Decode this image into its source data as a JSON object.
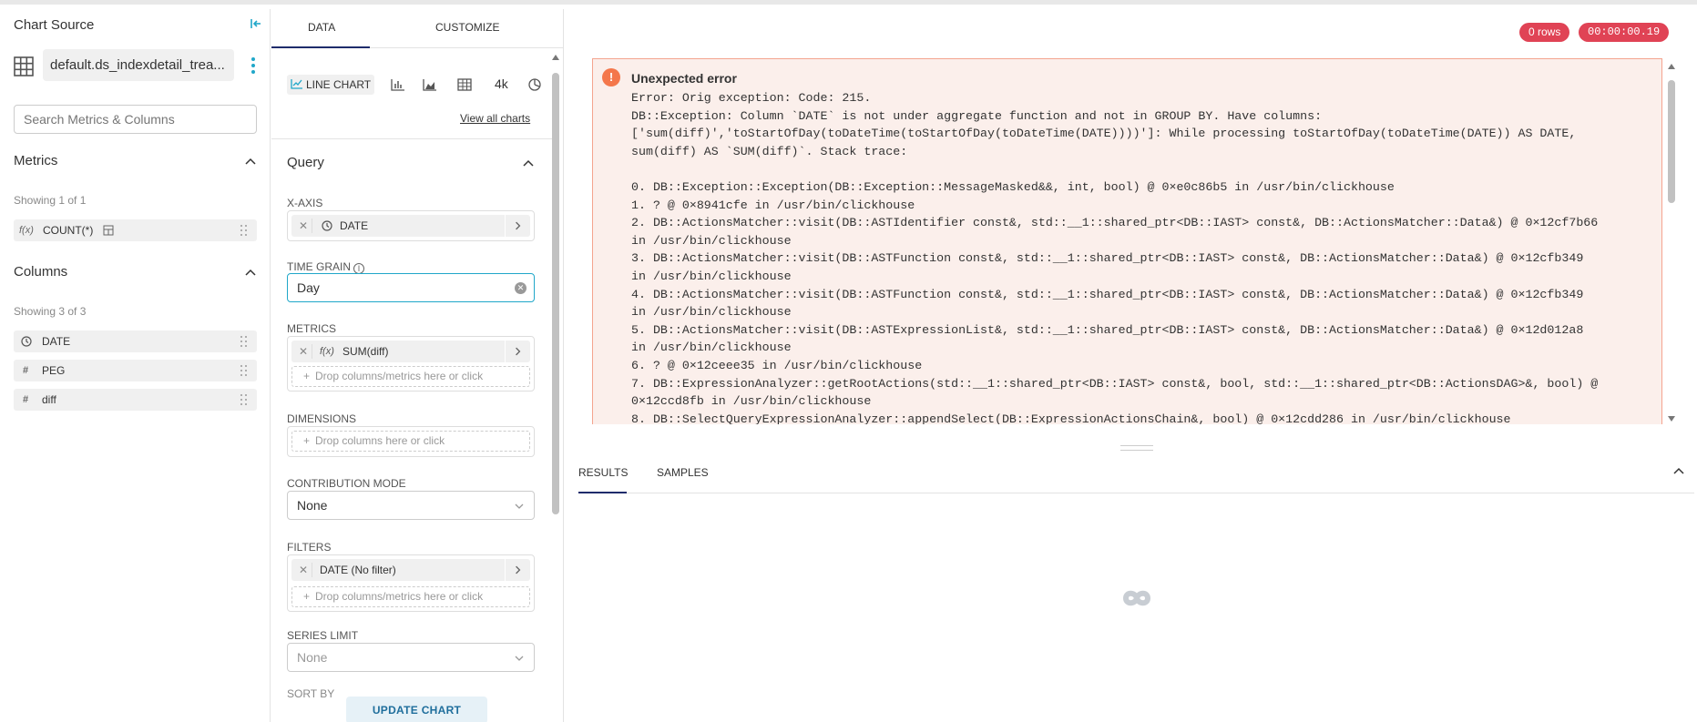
{
  "left_panel": {
    "title": "Chart Source",
    "dataset_name": "default.ds_indexdetail_trea...",
    "search_placeholder": "Search Metrics & Columns",
    "metrics": {
      "heading": "Metrics",
      "showing": "Showing 1 of 1",
      "items": [
        {
          "icon": "f(x)",
          "label": "COUNT(*)"
        }
      ]
    },
    "columns": {
      "heading": "Columns",
      "showing": "Showing 3 of 3",
      "items": [
        {
          "icon": "clock-icon",
          "label": "DATE"
        },
        {
          "icon": "#",
          "label": "PEG"
        },
        {
          "icon": "#",
          "label": "diff"
        }
      ]
    }
  },
  "middle_panel": {
    "tabs": [
      "DATA",
      "CUSTOMIZE"
    ],
    "viz": {
      "current": "LINE CHART",
      "big_number_label": "4k",
      "view_all": "View all charts"
    },
    "query_heading": "Query",
    "x_axis": {
      "label": "X-AXIS",
      "value": "DATE"
    },
    "time_grain": {
      "label": "TIME GRAIN",
      "value": "Day"
    },
    "metrics": {
      "label": "METRICS",
      "value": "SUM(diff)",
      "drop_hint": "Drop columns/metrics here or click"
    },
    "dimensions": {
      "label": "DIMENSIONS",
      "drop_hint": "Drop columns here or click"
    },
    "contribution_mode": {
      "label": "CONTRIBUTION MODE",
      "value": "None"
    },
    "filters": {
      "label": "FILTERS",
      "value": "DATE (No filter)",
      "drop_hint": "Drop columns/metrics here or click"
    },
    "series_limit": {
      "label": "SERIES LIMIT",
      "value": "None"
    },
    "sort_by": {
      "label": "SORT BY"
    },
    "update_button": "UPDATE CHART"
  },
  "right_panel": {
    "rows_badge": "0 rows",
    "timer_badge": "00:00:00.19",
    "error": {
      "title": "Unexpected error",
      "body": "Error: Orig exception: Code: 215.\nDB::Exception: Column `DATE` is not under aggregate function and not in GROUP BY. Have columns:\n['sum(diff)','toStartOfDay(toDateTime(toStartOfDay(toDateTime(DATE))))']: While processing toStartOfDay(toDateTime(DATE)) AS DATE,\nsum(diff) AS `SUM(diff)`. Stack trace:\n\n0. DB::Exception::Exception(DB::Exception::MessageMasked&&, int, bool) @ 0×e0c86b5 in /usr/bin/clickhouse\n1. ? @ 0×8941cfe in /usr/bin/clickhouse\n2. DB::ActionsMatcher::visit(DB::ASTIdentifier const&, std::__1::shared_ptr<DB::IAST> const&, DB::ActionsMatcher::Data&) @ 0×12cf7b66\nin /usr/bin/clickhouse\n3. DB::ActionsMatcher::visit(DB::ASTFunction const&, std::__1::shared_ptr<DB::IAST> const&, DB::ActionsMatcher::Data&) @ 0×12cfb349\nin /usr/bin/clickhouse\n4. DB::ActionsMatcher::visit(DB::ASTFunction const&, std::__1::shared_ptr<DB::IAST> const&, DB::ActionsMatcher::Data&) @ 0×12cfb349\nin /usr/bin/clickhouse\n5. DB::ActionsMatcher::visit(DB::ASTExpressionList&, std::__1::shared_ptr<DB::IAST> const&, DB::ActionsMatcher::Data&) @ 0×12d012a8\nin /usr/bin/clickhouse\n6. ? @ 0×12ceee35 in /usr/bin/clickhouse\n7. DB::ExpressionAnalyzer::getRootActions(std::__1::shared_ptr<DB::IAST> const&, bool, std::__1::shared_ptr<DB::ActionsDAG>&, bool) @\n0×12ccd8fb in /usr/bin/clickhouse\n8. DB::SelectQueryExpressionAnalyzer::appendSelect(DB::ExpressionActionsChain&, bool) @ 0×12cdd286 in /usr/bin/clickhouse"
    },
    "result_tabs": [
      "RESULTS",
      "SAMPLES"
    ]
  },
  "colors": {
    "accent": "#20a7c9",
    "error_badge": "#e04355",
    "error_bg": "#fbefeb",
    "error_border": "#f4a48f",
    "tab_active": "#1f2c6b"
  }
}
